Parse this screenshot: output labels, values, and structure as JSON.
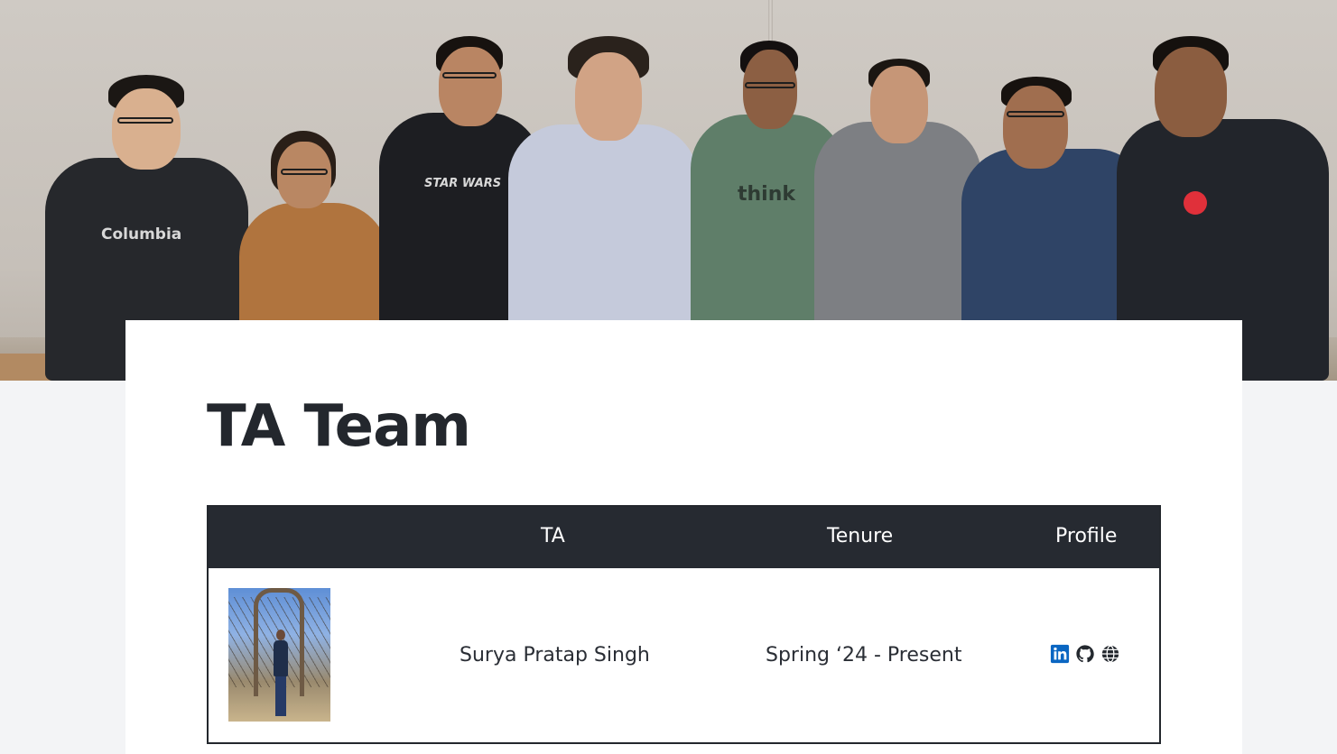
{
  "hero": {
    "people": [
      {
        "hoodie_text": "Columbia"
      },
      {
        "hoodie_text": ""
      },
      {
        "hoodie_text": "STAR WARS"
      },
      {
        "hoodie_text": ""
      },
      {
        "hoodie_text": "think"
      },
      {
        "hoodie_text": ""
      },
      {
        "hoodie_text": ""
      },
      {
        "hoodie_text": ""
      }
    ]
  },
  "page": {
    "title": "TA Team"
  },
  "table": {
    "headers": {
      "photo": "",
      "ta": "TA",
      "tenure": "Tenure",
      "profile": "Profile"
    },
    "rows": [
      {
        "name": "Surya Pratap Singh",
        "tenure": "Spring ‘24 - Present",
        "profile_icons": [
          "linkedin-icon",
          "github-icon",
          "globe-icon"
        ]
      }
    ]
  },
  "colors": {
    "header_bg": "#262a31",
    "title": "#23272d",
    "linkedin": "#0a66c2",
    "card_bg": "#ffffff",
    "page_bg": "#f3f4f6"
  }
}
